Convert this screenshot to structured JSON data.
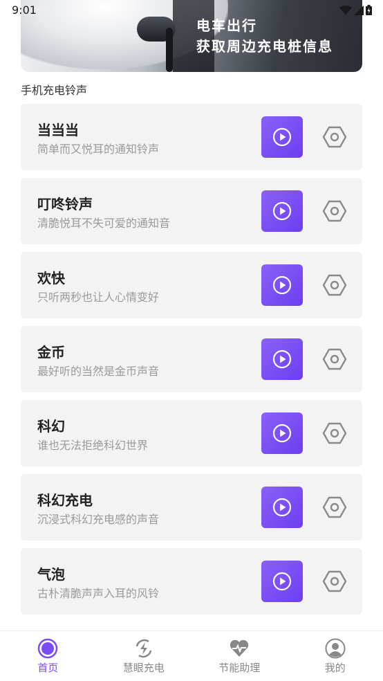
{
  "status_bar": {
    "time": "9:01"
  },
  "banner": {
    "line1": "电车出行",
    "line2": "获取周边充电桩信息"
  },
  "section_title": "手机充电铃声",
  "ringtones": [
    {
      "title": "当当当",
      "desc": "简单而又悦耳的通知铃声"
    },
    {
      "title": "叮咚铃声",
      "desc": "清脆悦耳不失可爱的通知音"
    },
    {
      "title": "欢快",
      "desc": "只听两秒也让人心情变好"
    },
    {
      "title": "金币",
      "desc": "最好听的当然是金币声音"
    },
    {
      "title": "科幻",
      "desc": "谁也无法拒绝科幻世界"
    },
    {
      "title": "科幻充电",
      "desc": "沉浸式科幻充电感的声音"
    },
    {
      "title": "气泡",
      "desc": "古朴清脆声声入耳的风铃"
    }
  ],
  "tabs": [
    {
      "label": "首页",
      "active": true
    },
    {
      "label": "慧眼充电",
      "active": false
    },
    {
      "label": "节能助理",
      "active": false
    },
    {
      "label": "我的",
      "active": false
    }
  ],
  "colors": {
    "accent": "#7b4cf3",
    "play_button": "#7447f1",
    "card_bg": "#f3f3f4",
    "inactive_tab": "#888888"
  },
  "icons": {
    "play": "play-circle-icon",
    "settings": "hexagon-settings-icon"
  }
}
